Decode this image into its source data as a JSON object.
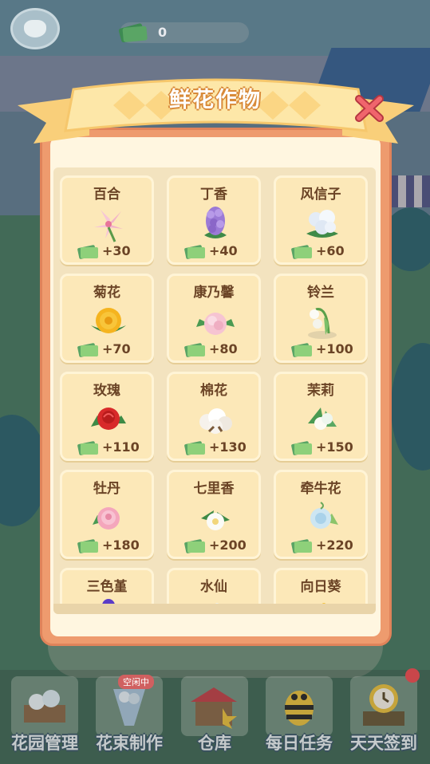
{
  "hud": {
    "cash_amount": "0"
  },
  "panel": {
    "title": "鲜花作物"
  },
  "crops": [
    {
      "name": "百合",
      "reward": "+30"
    },
    {
      "name": "丁香",
      "reward": "+40"
    },
    {
      "name": "风信子",
      "reward": "+60"
    },
    {
      "name": "菊花",
      "reward": "+70"
    },
    {
      "name": "康乃馨",
      "reward": "+80"
    },
    {
      "name": "铃兰",
      "reward": "+100"
    },
    {
      "name": "玫瑰",
      "reward": "+110"
    },
    {
      "name": "棉花",
      "reward": "+130"
    },
    {
      "name": "茉莉",
      "reward": "+150"
    },
    {
      "name": "牡丹",
      "reward": "+180"
    },
    {
      "name": "七里香",
      "reward": "+200"
    },
    {
      "name": "牵牛花",
      "reward": "+220"
    },
    {
      "name": "三色堇",
      "reward": ""
    },
    {
      "name": "水仙",
      "reward": ""
    },
    {
      "name": "向日葵",
      "reward": ""
    }
  ],
  "nav": {
    "items": [
      {
        "label": "花园管理"
      },
      {
        "label": "花束制作"
      },
      {
        "label": "仓库"
      },
      {
        "label": "每日任务"
      },
      {
        "label": "天天签到"
      }
    ],
    "badge": "空闲中"
  },
  "colors": {
    "panel_border": "#ee9b6e",
    "card_bg": "#fce8b8",
    "text_brown": "#6b4426",
    "money_green": "#7cc46a",
    "close_red": "#e4525a"
  }
}
